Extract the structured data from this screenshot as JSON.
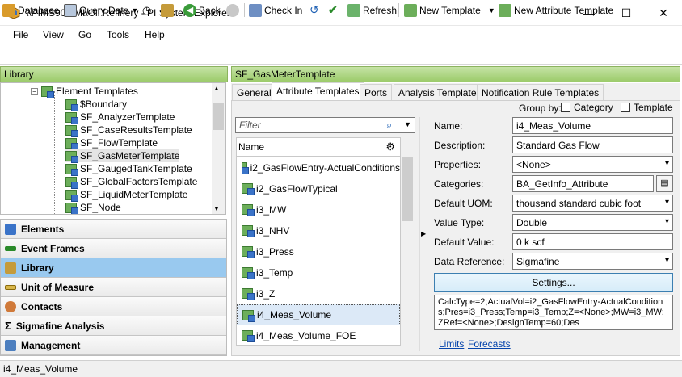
{
  "window": {
    "title": "\\\\PIMS901-MI\\Oil Refinery - PI System Explorer",
    "minimize": "—",
    "maximize": "☐",
    "close": "✕"
  },
  "menu": [
    "File",
    "View",
    "Go",
    "Tools",
    "Help"
  ],
  "toolbar": {
    "database": "Database",
    "query_date": "Query Date",
    "back": "Back",
    "check_in": "Check In",
    "refresh": "Refresh",
    "new_template": "New Template",
    "new_attribute_template": "New Attribute Template"
  },
  "library": {
    "header": "Library",
    "root": "Element Templates",
    "items": [
      "$Boundary",
      "SF_AnalyzerTemplate",
      "SF_CaseResultsTemplate",
      "SF_FlowTemplate",
      "SF_GasMeterTemplate",
      "SF_GaugedTankTemplate",
      "SF_GlobalFactorsTemplate",
      "SF_LiquidMeterTemplate",
      "SF_Node"
    ]
  },
  "nav": [
    "Elements",
    "Event Frames",
    "Library",
    "Unit of Measure",
    "Contacts",
    "Sigmafine Analysis",
    "Management"
  ],
  "template": {
    "header": "SF_GasMeterTemplate",
    "tabs": [
      "General",
      "Attribute Templates",
      "Ports",
      "Analysis Templates",
      "Notification Rule Templates"
    ],
    "group_by": "Group by:",
    "group_category": "Category",
    "group_template": "Template",
    "filter_placeholder": "Filter",
    "list_header": "Name",
    "attributes": [
      "i2_GasFlowEntry-ActualConditions",
      "i2_GasFlowTypical",
      "i3_MW",
      "i3_NHV",
      "i3_Press",
      "i3_Temp",
      "i3_Z",
      "i4_Meas_Volume",
      "i4_Meas_Volume_FOE"
    ]
  },
  "form": {
    "name_label": "Name:",
    "name": "i4_Meas_Volume",
    "description_label": "Description:",
    "description": "Standard Gas Flow",
    "properties_label": "Properties:",
    "properties": "<None>",
    "categories_label": "Categories:",
    "categories": "BA_GetInfo_Attribute",
    "uom_label": "Default UOM:",
    "uom": "thousand standard cubic foot",
    "value_type_label": "Value Type:",
    "value_type": "Double",
    "default_value_label": "Default Value:",
    "default_value": "0 k scf",
    "data_reference_label": "Data Reference:",
    "data_reference": "Sigmafine",
    "settings": "Settings...",
    "config": "CalcType=2;ActualVol=i2_GasFlowEntry-ActualConditions;Pres=i3_Press;Temp=i3_Temp;Z=<None>;MW=i3_MW;ZRef=<None>;DesignTemp=60;Des",
    "limits": "Limits",
    "forecasts": "Forecasts"
  },
  "status": "i4_Meas_Volume"
}
